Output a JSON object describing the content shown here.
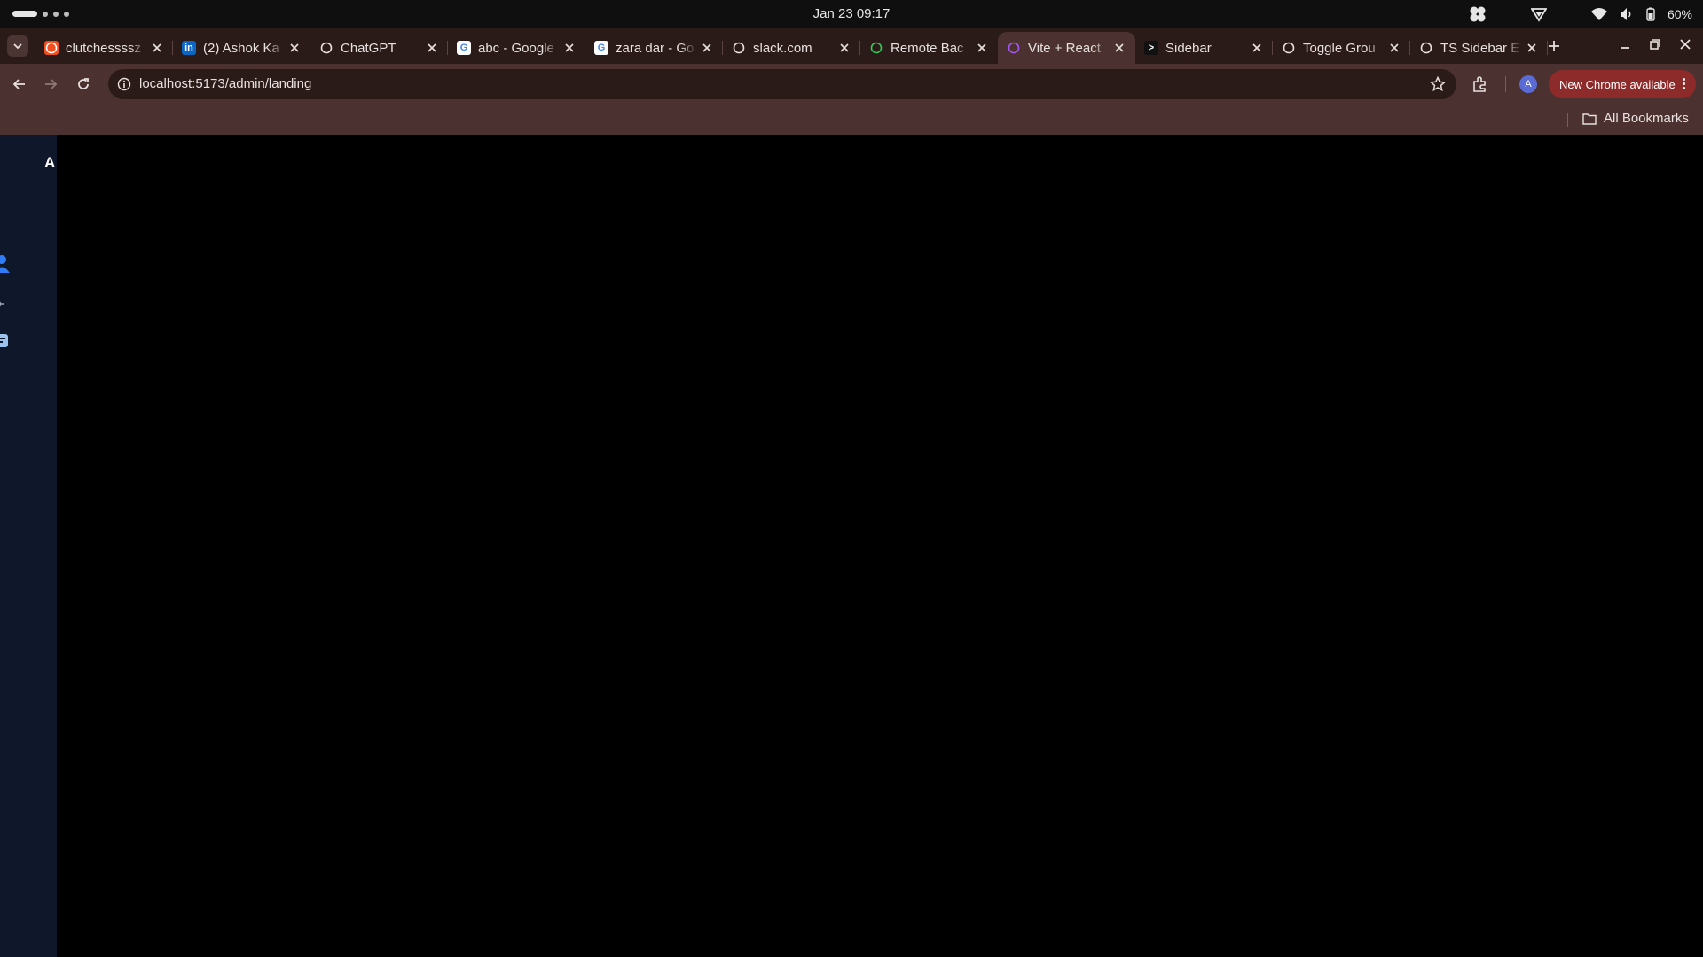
{
  "os": {
    "clock": "Jan 23  09:17",
    "battery": "60%"
  },
  "tabs": [
    {
      "title": "clutchessssz",
      "icon": "figma-icon"
    },
    {
      "title": "(2) Ashok Ka",
      "icon": "linkedin-icon",
      "badge": "in"
    },
    {
      "title": "ChatGPT",
      "icon": "chatgpt-icon"
    },
    {
      "title": "abc - Google",
      "icon": "google-icon",
      "badge": "G"
    },
    {
      "title": "zara dar - Go",
      "icon": "google-icon",
      "badge": "G"
    },
    {
      "title": "slack.com",
      "icon": "globe-icon"
    },
    {
      "title": "Remote Bac",
      "icon": "remote-icon"
    },
    {
      "title": "Vite + React",
      "icon": "vite-icon",
      "active": true
    },
    {
      "title": "Sidebar",
      "icon": "terminal-icon",
      "badge": ">"
    },
    {
      "title": "Toggle Grou",
      "icon": "slash-icon"
    },
    {
      "title": "TS Sidebar E",
      "icon": "chatgpt-icon"
    }
  ],
  "toolbar": {
    "url": "localhost:5173/admin/landing",
    "profile_initial": "A",
    "update_label": "New Chrome available"
  },
  "bookmarks": {
    "all_label": "All Bookmarks"
  },
  "app": {
    "logo_letter": "A"
  },
  "colors": {
    "sidebar_bg": "#0f172a",
    "accent_blue": "#2f7cf6",
    "frame": "#4b3230",
    "tabstrip": "#2a1a18",
    "update_chip": "#8d2a2a"
  }
}
